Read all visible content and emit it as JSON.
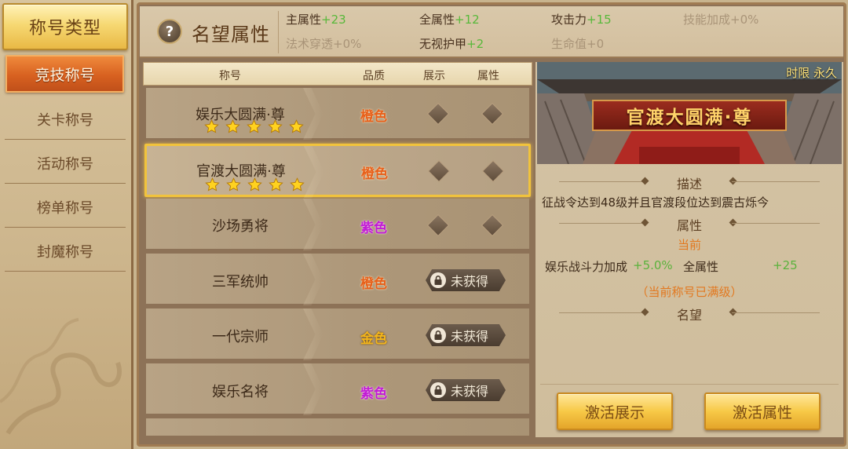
{
  "sidebar": {
    "header": "称号类型",
    "items": [
      {
        "label": "竞技称号",
        "active": true
      },
      {
        "label": "关卡称号",
        "active": false
      },
      {
        "label": "活动称号",
        "active": false
      },
      {
        "label": "榜单称号",
        "active": false
      },
      {
        "label": "封魔称号",
        "active": false
      }
    ]
  },
  "header": {
    "help": "?",
    "title": "名望属性",
    "stats": [
      {
        "name": "主属性",
        "value": "+23"
      },
      {
        "name": "全属性",
        "value": "+12"
      },
      {
        "name": "攻击力",
        "value": "+15"
      },
      {
        "name": "技能加成",
        "value": "+0%"
      },
      {
        "name": "法术穿透",
        "value": "+0%"
      },
      {
        "name": "无视护甲",
        "value": "+2"
      },
      {
        "name": "生命值",
        "value": "+0"
      }
    ]
  },
  "table": {
    "columns": [
      "称号",
      "品质",
      "展示",
      "属性"
    ],
    "rows": [
      {
        "name": "娱乐大圆满·尊",
        "quality": "橙色",
        "stars": 5,
        "obtained": true
      },
      {
        "name": "官渡大圆满·尊",
        "quality": "橙色",
        "stars": 5,
        "obtained": true,
        "selected": true
      },
      {
        "name": "沙场勇将",
        "quality": "紫色",
        "stars": 0,
        "obtained": true
      },
      {
        "name": "三军统帅",
        "quality": "橙色",
        "stars": 0,
        "obtained": false
      },
      {
        "name": "一代宗师",
        "quality": "金色",
        "stars": 0,
        "obtained": false
      },
      {
        "name": "娱乐名将",
        "quality": "紫色",
        "stars": 0,
        "obtained": false
      }
    ],
    "locked_label": "未获得"
  },
  "detail": {
    "duration": "时限 永久",
    "banner_title": "官渡大圆满·尊",
    "desc_title": "描述",
    "desc_text": "征战令达到48级并且官渡段位达到震古烁今",
    "attr_title": "属性",
    "current_label": "当前",
    "attr1_name": "娱乐战斗力加成",
    "attr1_value": "+5.0%",
    "attr2_name": "全属性",
    "attr2_value": "+25",
    "maxed_note": "（当前称号已满级）",
    "fame_title": "名望",
    "btn_display": "激活展示",
    "btn_attr": "激活属性"
  },
  "colors": {
    "quality_orange": "#e8601a",
    "quality_purple": "#c21ad6",
    "quality_gold": "#f3b51b",
    "stat_green": "#58b83a",
    "highlight": "#f1c33c"
  }
}
